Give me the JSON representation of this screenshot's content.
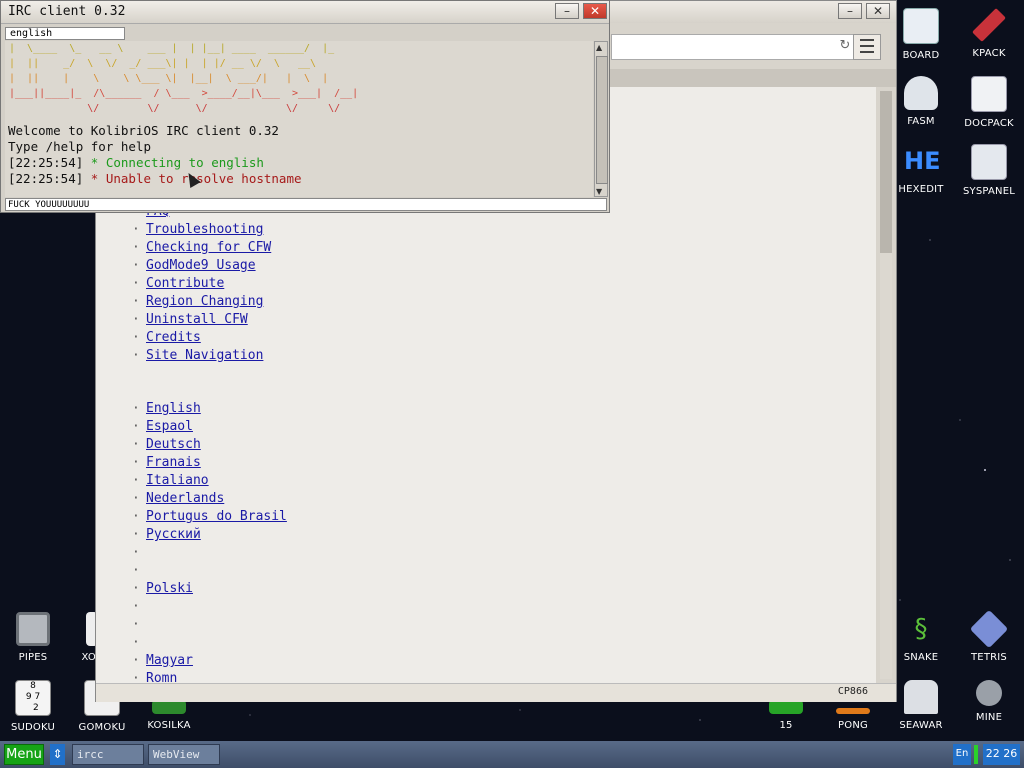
{
  "irc": {
    "title": "IRC client 0.32",
    "channel_tab": "english",
    "ascii_art": [
      "|  \\____  \\_   __ \\    ___ |  | |__| ____  ______/  |_",
      "|  ||    _/  \\  \\/  _/ ___\\| |  | |/ __ \\/  \\   __\\",
      "|  ||    |    \\    \\ \\___ \\|  |__|  \\ ___/|   |  \\  |",
      "|___||____|_  /\\______  / \\___  >____/__|\\___  >___|  /__|",
      "             \\/        \\/      \\/             \\/     \\/"
    ],
    "messages": [
      {
        "text": "Welcome to KolibriOS IRC client 0.32",
        "color": "#111111"
      },
      {
        "text": "Type /help for help",
        "color": "#111111"
      },
      {
        "time": "[22:25:54]",
        "text": " * Connecting to english",
        "color": "#1c9a1c"
      },
      {
        "time": "[22:25:54]",
        "text": " * Unable to resolve hostname",
        "color": "#a61a1a"
      }
    ],
    "input_value": "FUCK YOUUUUUUUU"
  },
  "browser": {
    "status_encoding": "CP866",
    "links_group1": [
      "FAQ",
      "Troubleshooting",
      "Checking for CFW",
      "GodMode9 Usage",
      "Contribute",
      "Region Changing",
      "Uninstall CFW",
      "Credits",
      "Site Navigation"
    ],
    "links_group2": [
      "English",
      "Espaol",
      "Deutsch",
      "Franais",
      "Italiano",
      "Nederlands",
      "Portugus do Brasil",
      "Русский",
      "",
      "",
      "Polski",
      "",
      "",
      "",
      "Magyar",
      "Romn"
    ]
  },
  "desktop_icons_right": [
    {
      "label": "BOARD",
      "icon": "board-icon"
    },
    {
      "label": "KPACK",
      "icon": "kpack-icon"
    },
    {
      "label": "FASM",
      "icon": "fasm-icon"
    },
    {
      "label": "DOCPACK",
      "icon": "docpack-icon"
    },
    {
      "label": "HEXEDIT",
      "icon": "hexedit-icon"
    },
    {
      "label": "SYSPANEL",
      "icon": "syspanel-icon"
    },
    {
      "label": "SNAKE",
      "icon": "snake-icon"
    },
    {
      "label": "TETRIS",
      "icon": "tetris-icon"
    },
    {
      "label": "SEAWAR",
      "icon": "seawar-icon"
    },
    {
      "label": "MINE",
      "icon": "mine-icon"
    }
  ],
  "desktop_icons_left": [
    {
      "label": "PIPES",
      "icon": "pipes-icon"
    },
    {
      "label": "XO",
      "icon": "xo-icon"
    },
    {
      "label": "SUDOKU",
      "icon": "sudoku-icon"
    },
    {
      "label": "GOMOKU",
      "icon": "gomoku-icon"
    },
    {
      "label": "KOSILKA",
      "icon": "kosilka-icon"
    },
    {
      "label": "15",
      "icon": "fifteen-icon"
    },
    {
      "label": "PONG",
      "icon": "pong-icon"
    }
  ],
  "sudoku_digits": [
    "8",
    "9",
    "7",
    "2"
  ],
  "hexedit_glyph": "HE",
  "taskbar": {
    "menu_label": "Menu",
    "tasks": [
      "ircc",
      "WebView"
    ],
    "language": "En",
    "clock": "22 26"
  }
}
